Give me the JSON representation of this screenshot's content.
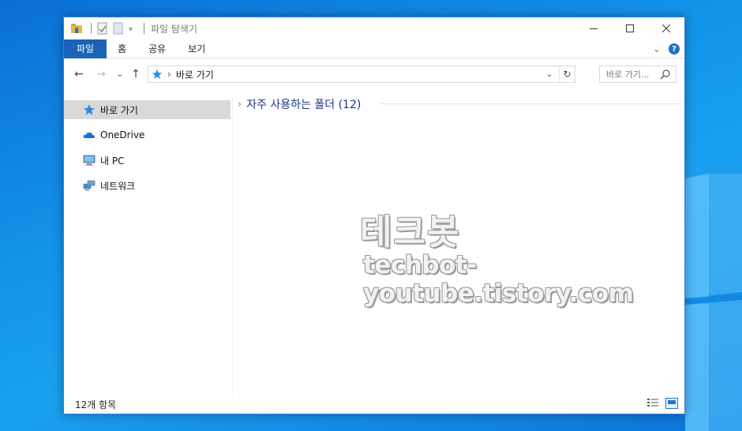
{
  "window": {
    "title": "파일 탐색기",
    "minimize_glyph": "—",
    "maximize_glyph": "☐",
    "close_glyph": "✕"
  },
  "ribbon": {
    "tabs": [
      {
        "label": "파일"
      },
      {
        "label": "홈"
      },
      {
        "label": "공유"
      },
      {
        "label": "보기"
      }
    ],
    "expand_glyph": "⌄",
    "help_glyph": "?"
  },
  "navigation": {
    "back_glyph": "←",
    "forward_glyph": "→",
    "recent_glyph": "⌄",
    "up_glyph": "↑",
    "address_separator": "›",
    "address_location": "바로 가기",
    "address_dropdown_glyph": "⌄",
    "refresh_glyph": "↻",
    "search_placeholder": "바로 가기..."
  },
  "sidebar": {
    "items": [
      {
        "label": "바로 가기",
        "icon": "quick-access-star-icon",
        "selected": true
      },
      {
        "label": "OneDrive",
        "icon": "onedrive-cloud-icon",
        "selected": false
      },
      {
        "label": "내 PC",
        "icon": "computer-icon",
        "selected": false
      },
      {
        "label": "네트워크",
        "icon": "network-icon",
        "selected": false
      }
    ]
  },
  "main": {
    "group_chevron": "›",
    "group_label": "자주 사용하는 폴더 (12)"
  },
  "status": {
    "item_count": "12개 항목"
  },
  "watermark": {
    "title": "테크봇",
    "url": "techbot-youtube.tistory.com"
  },
  "colors": {
    "accent": "#1a63b7",
    "group_header": "#1e3287",
    "selection": "#d9d9d9",
    "desktop": "#1394ea"
  }
}
